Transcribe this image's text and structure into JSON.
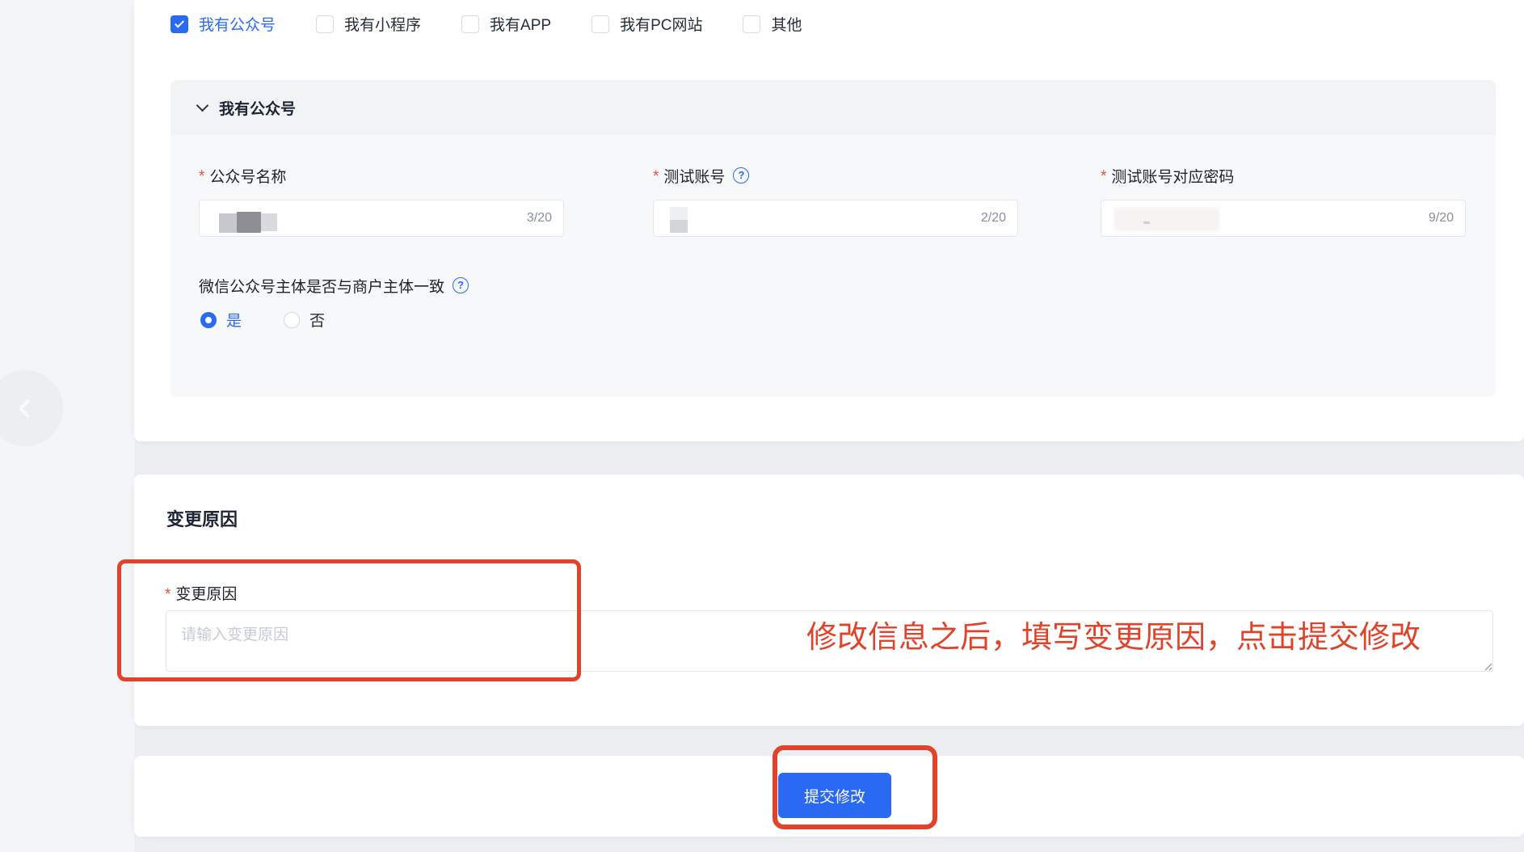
{
  "ui": {
    "required_marker": "*",
    "help_glyph": "?"
  },
  "colors": {
    "accent_blue": "#2a6af2",
    "annotation_red": "#e0432a",
    "required_red": "#f04c3a"
  },
  "channel_options": [
    {
      "label": "我有公众号",
      "checked": true
    },
    {
      "label": "我有小程序",
      "checked": false
    },
    {
      "label": "我有APP",
      "checked": false
    },
    {
      "label": "我有PC网站",
      "checked": false
    },
    {
      "label": "其他",
      "checked": false
    }
  ],
  "panel": {
    "title": "我有公众号",
    "fields": [
      {
        "label": "公众号名称",
        "counter": "3/20"
      },
      {
        "label": "测试账号",
        "counter": "2/20"
      },
      {
        "label": "测试账号对应密码",
        "counter": "9/20"
      }
    ],
    "radio_question": {
      "label": "微信公众号主体是否与商户主体一致",
      "options": [
        {
          "label": "是",
          "selected": true
        },
        {
          "label": "否",
          "selected": false
        }
      ]
    }
  },
  "change_reason": {
    "section_title": "变更原因",
    "field_label": "变更原因",
    "placeholder": "请输入变更原因"
  },
  "annotation_note": "修改信息之后，填写变更原因，点击提交修改",
  "footer": {
    "submit_label": "提交修改"
  }
}
